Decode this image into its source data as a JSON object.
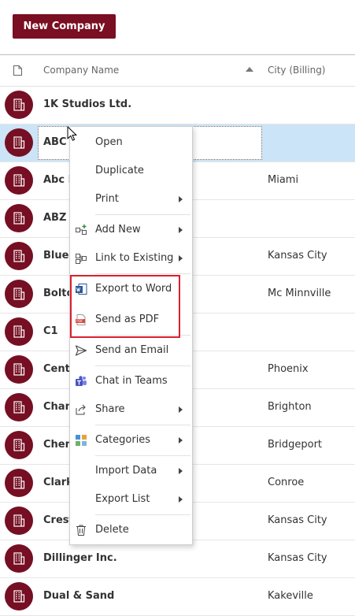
{
  "toolbar": {
    "new_company_label": "New Company"
  },
  "columns": {
    "name": "Company Name",
    "city": "City (Billing)"
  },
  "rows": [
    {
      "name": "1K Studios Ltd.",
      "city": ""
    },
    {
      "name": "ABC c",
      "city": ""
    },
    {
      "name": "Abc B",
      "city": "Miami"
    },
    {
      "name": "ABZ c",
      "city": ""
    },
    {
      "name": "BlueP",
      "city": "Kansas City"
    },
    {
      "name": "Bolto",
      "city": "Mc Minnville"
    },
    {
      "name": "C1",
      "city": ""
    },
    {
      "name": "Centu",
      "city": "Phoenix"
    },
    {
      "name": "Chan",
      "city": "Brighton"
    },
    {
      "name": "Chem",
      "city": "Bridgeport"
    },
    {
      "name": "Clark",
      "city": "Conroe"
    },
    {
      "name": "Crest",
      "city": "Kansas City"
    },
    {
      "name": "Dillinger Inc.",
      "city": "Kansas City"
    },
    {
      "name": "Dual & Sand",
      "city": "Kakeville"
    }
  ],
  "context_menu": {
    "items": [
      {
        "label": "Open",
        "icon": "",
        "submenu": false
      },
      {
        "label": "Duplicate",
        "icon": "",
        "submenu": false
      },
      {
        "label": "Print",
        "icon": "",
        "submenu": true
      },
      {
        "label": "Add New",
        "icon": "add-new-icon",
        "submenu": true
      },
      {
        "label": "Link to Existing",
        "icon": "link-icon",
        "submenu": true
      },
      {
        "label": "Export to Word",
        "icon": "word-icon",
        "submenu": false
      },
      {
        "label": "Send as PDF",
        "icon": "pdf-icon",
        "submenu": false
      },
      {
        "label": "Send an Email",
        "icon": "send-icon",
        "submenu": false
      },
      {
        "label": "Chat in Teams",
        "icon": "teams-icon",
        "submenu": false
      },
      {
        "label": "Share",
        "icon": "share-icon",
        "submenu": true
      },
      {
        "label": "Categories",
        "icon": "categories-icon",
        "submenu": true
      },
      {
        "label": "Import Data",
        "icon": "",
        "submenu": true
      },
      {
        "label": "Export List",
        "icon": "",
        "submenu": true
      },
      {
        "label": "Delete",
        "icon": "delete-icon",
        "submenu": false
      }
    ]
  },
  "colors": {
    "brand": "#7a0e22",
    "selection": "#cce4f7",
    "highlight_border": "#d9202f"
  }
}
